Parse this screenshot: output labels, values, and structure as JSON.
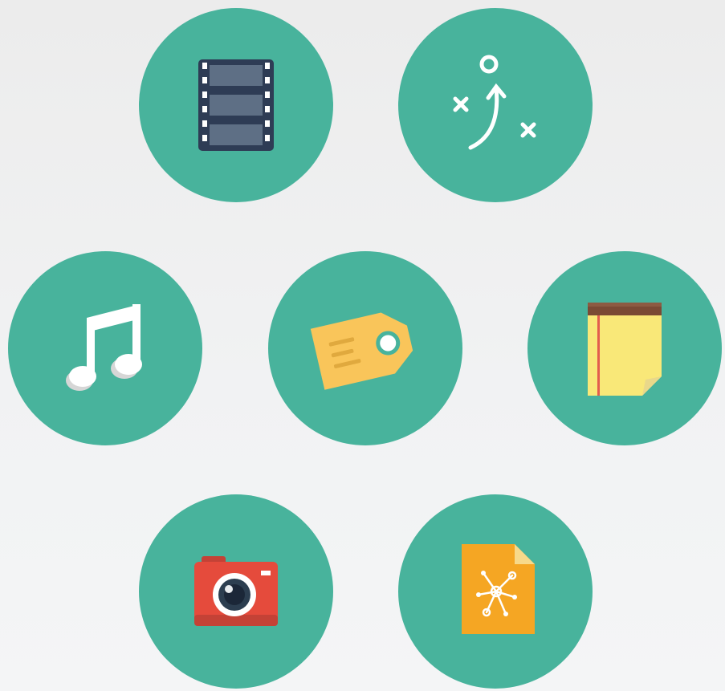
{
  "colors": {
    "circle": "#48b39c",
    "background": "#f1f2f3"
  },
  "icons": [
    {
      "id": "film",
      "icon": "film-strip-icon"
    },
    {
      "id": "play",
      "icon": "strategy-play-icon"
    },
    {
      "id": "music",
      "icon": "music-note-icon"
    },
    {
      "id": "tag",
      "icon": "price-tag-icon"
    },
    {
      "id": "note",
      "icon": "notepad-icon"
    },
    {
      "id": "camera",
      "icon": "camera-icon"
    },
    {
      "id": "share",
      "icon": "network-document-icon"
    }
  ]
}
